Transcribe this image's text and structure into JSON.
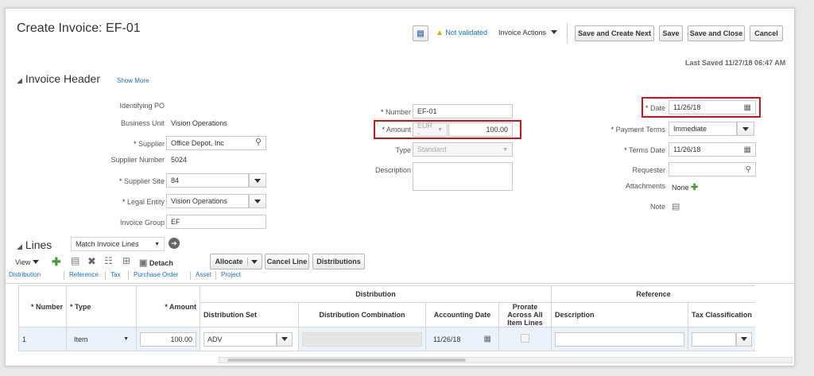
{
  "page": {
    "title": "Create Invoice: EF-01"
  },
  "toolbar": {
    "status_icon": "warning-icon",
    "status_text": "Not validated",
    "invoice_actions": "Invoice Actions",
    "save_create_next": "Save and Create Next",
    "save": "Save",
    "save_close": "Save and Close",
    "cancel": "Cancel",
    "last_saved": "Last Saved  11/27/18 06:47 AM"
  },
  "header": {
    "section_title": "Invoice Header",
    "show_more": "Show More",
    "identifying_po_label": "Identifying PO",
    "business_unit_label": "Business Unit",
    "business_unit": "Vision Operations",
    "supplier_label": "Supplier",
    "supplier": "Office Depot, Inc",
    "supplier_number_label": "Supplier Number",
    "supplier_number": "5024",
    "supplier_site_label": "Supplier Site",
    "supplier_site": "84",
    "legal_entity_label": "Legal Entity",
    "legal_entity": "Vision Operations",
    "invoice_group_label": "Invoice Group",
    "invoice_group": "EF",
    "number_label": "Number",
    "number": "EF-01",
    "amount_label": "Amount",
    "currency": "EUR -",
    "amount": "100.00",
    "type_label": "Type",
    "type": "Standard",
    "description_label": "Description",
    "date_label": "Date",
    "date": "11/26/18",
    "payment_terms_label": "Payment Terms",
    "payment_terms": "Immediate",
    "terms_date_label": "Terms Date",
    "terms_date": "11/26/18",
    "requester_label": "Requester",
    "attachments_label": "Attachments",
    "attachments": "None",
    "note_label": "Note"
  },
  "lines": {
    "section_title": "Lines",
    "match_select": "Match Invoice Lines",
    "view": "View",
    "detach": "Detach",
    "allocate": "Allocate",
    "cancel_line": "Cancel Line",
    "distributions": "Distributions",
    "tabs": [
      "Distribution",
      "Reference",
      "Tax",
      "Purchase Order",
      "Asset",
      "Project"
    ],
    "group_distribution": "Distribution",
    "group_reference": "Reference",
    "columns": {
      "number": "Number",
      "type": "Type",
      "amount": "Amount",
      "distribution_set": "Distribution Set",
      "distribution_combination": "Distribution Combination",
      "accounting_date": "Accounting Date",
      "prorate": "Prorate Across All Item Lines",
      "description": "Description",
      "tax_classification": "Tax Classification"
    },
    "row": {
      "number": "1",
      "type": "Item",
      "amount": "100.00",
      "distribution_set": "ADV",
      "accounting_date": "11/26/18"
    }
  },
  "colors": {
    "highlight": "#d0121b",
    "link": "#1f6fb7",
    "row_selected": "#eaf2fb"
  }
}
